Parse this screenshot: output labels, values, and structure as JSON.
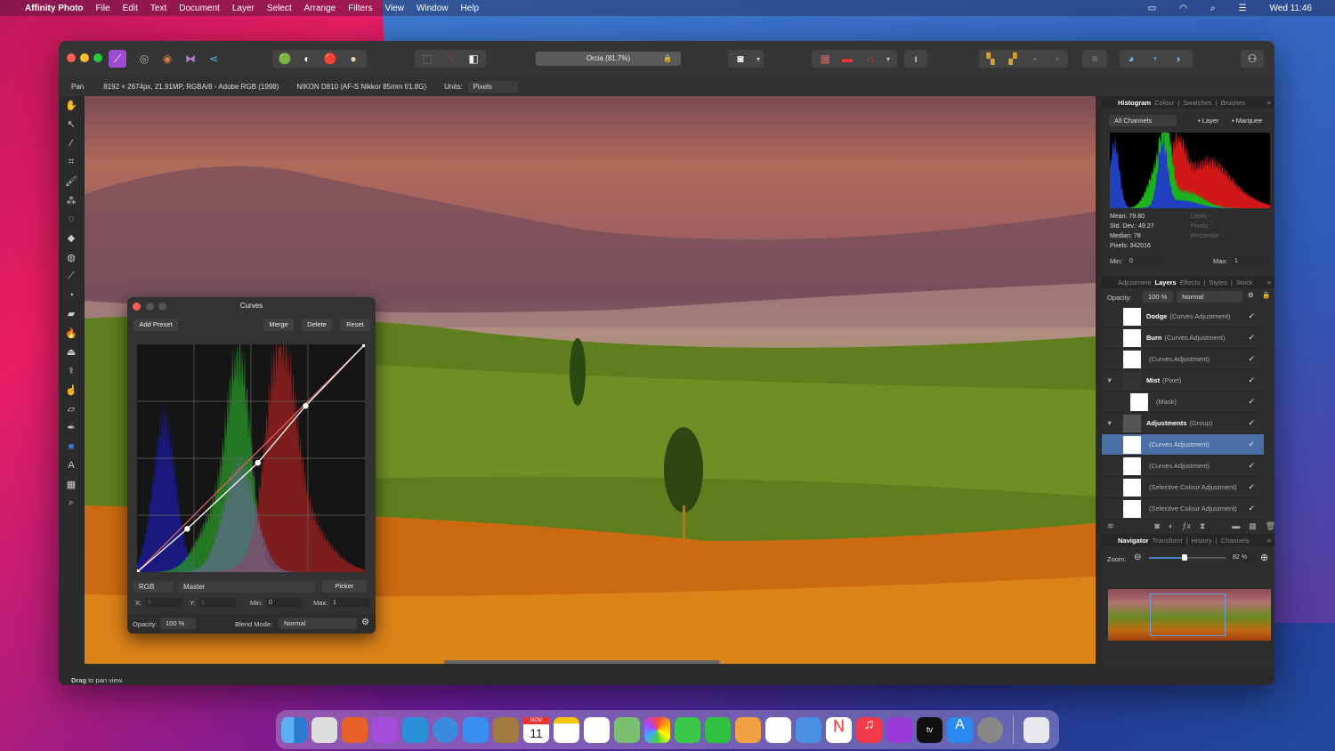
{
  "menubar": {
    "app": "Affinity Photo",
    "items": [
      "File",
      "Edit",
      "Text",
      "Document",
      "Layer",
      "Select",
      "Arrange",
      "Filters",
      "View",
      "Window",
      "Help"
    ],
    "clock": "Wed 11:46"
  },
  "toolbar": {
    "document_title": "Orcia (81.7%)"
  },
  "context": {
    "tool": "Pan",
    "doc_info": "8192 × 2674px, 21.91MP, RGBA/8 - Adobe RGB (1998)",
    "camera": "NIKON D810 (AF-S Nikkor 85mm f/1.8G)",
    "units_label": "Units:",
    "units_value": "Pixels"
  },
  "status": {
    "bold": "Drag",
    "text": "to pan view."
  },
  "histogram_panel": {
    "tabs": [
      "Histogram",
      "Colour",
      "Swatches",
      "Brushes"
    ],
    "channel": "All Channels",
    "layer_label": "Layer",
    "marquee_label": "Marquee",
    "stats": [
      "Mean: 79.80",
      "Std. Dev.: 49.27",
      "Median: 78",
      "Pixels: 342016"
    ],
    "stats_right": [
      "Level: -",
      "Pixels: -",
      "Percentile: -"
    ],
    "min_label": "Min:",
    "min": "0",
    "max_label": "Max:",
    "max": "1"
  },
  "layers_panel": {
    "tabs": [
      "Adjustment",
      "Layers",
      "Effects",
      "Styles",
      "Stock"
    ],
    "opacity_label": "Opacity:",
    "opacity": "100 %",
    "blend": "Normal",
    "layers": [
      {
        "name": "Dodge",
        "type": "(Curves Adjustment)",
        "checked": true
      },
      {
        "name": "Burn",
        "type": "(Curves Adjustment)",
        "checked": true
      },
      {
        "name": "",
        "type": "(Curves Adjustment)",
        "checked": true
      },
      {
        "name": "Mist",
        "type": "(Pixel)",
        "checked": true
      },
      {
        "name": "",
        "type": "(Mask)",
        "checked": true
      },
      {
        "name": "Adjustments",
        "type": "(Group)",
        "checked": true
      },
      {
        "name": "",
        "type": "(Curves Adjustment)",
        "checked": true,
        "selected": true
      },
      {
        "name": "",
        "type": "(Curves Adjustment)",
        "checked": true
      },
      {
        "name": "",
        "type": "(Selective Colour Adjustment)",
        "checked": true
      },
      {
        "name": "",
        "type": "(Selective Colour Adjustment)",
        "checked": true
      }
    ]
  },
  "navigator_panel": {
    "tabs": [
      "Navigator",
      "Transform",
      "History",
      "Channels"
    ],
    "zoom_label": "Zoom:",
    "zoom_value": "82 %",
    "zoom_fraction": 0.47
  },
  "curves": {
    "title": "Curves",
    "add_preset": "Add Preset",
    "merge": "Merge",
    "delete": "Delete",
    "reset": "Reset",
    "color_space": "RGB",
    "channel": "Master",
    "picker": "Picker",
    "x_label": "X:",
    "x": "0",
    "y_label": "Y:",
    "y": "1",
    "min_label": "Min:",
    "min": "0",
    "max_label": "Max:",
    "max": "1",
    "opacity_label": "Opacity:",
    "opacity": "100 %",
    "blend_label": "Blend Mode:",
    "blend": "Normal",
    "points": [
      [
        0,
        0
      ],
      [
        0.22,
        0.19
      ],
      [
        0.53,
        0.48
      ],
      [
        0.74,
        0.73
      ],
      [
        1,
        1
      ]
    ]
  },
  "dock": {
    "calendar_month": "NOV",
    "calendar_day": "11",
    "tv": "tv"
  }
}
